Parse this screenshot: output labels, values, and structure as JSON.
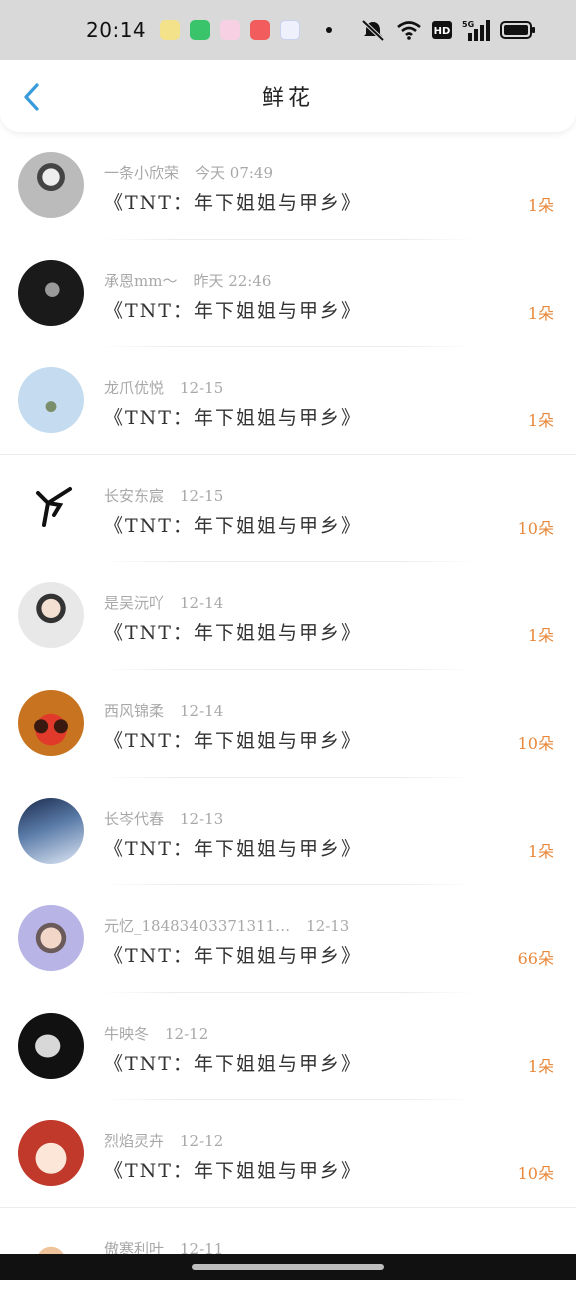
{
  "status_bar": {
    "time": "20:14",
    "icons": [
      "face-app-icon",
      "shopping-app-icon",
      "pink-app-icon",
      "store-app-icon",
      "browser-app-icon"
    ],
    "right_icons": [
      "mute-icon",
      "wifi-icon",
      "hd-icon",
      "signal-5g-icon",
      "battery-icon"
    ]
  },
  "header": {
    "title": "鲜花",
    "back_icon": "chevron-left-icon"
  },
  "accent_color": "#e8883a",
  "items": [
    {
      "name": "一条小欣荣",
      "time": "今天 07:49",
      "gift": "《TNT：年下姐姐与甲乡》",
      "count": "1朵",
      "avatar": "portrait-bw"
    },
    {
      "name": "承恩mm～",
      "time": "昨天 22:46",
      "gift": "《TNT：年下姐姐与甲乡》",
      "count": "1朵",
      "avatar": "portrait-dark"
    },
    {
      "name": "龙爪优悦",
      "time": "12-15",
      "gift": "《TNT：年下姐姐与甲乡》",
      "count": "1朵",
      "avatar": "sky-plant"
    },
    {
      "name": "长安东宸",
      "time": "12-15",
      "gift": "《TNT：年下姐姐与甲乡》",
      "count": "10朵",
      "avatar": "glyph"
    },
    {
      "name": "是吴沅吖",
      "time": "12-14",
      "gift": "《TNT：年下姐姐与甲乡》",
      "count": "1朵",
      "avatar": "portrait-light"
    },
    {
      "name": "西风锦柔",
      "time": "12-14",
      "gift": "《TNT：年下姐姐与甲乡》",
      "count": "10朵",
      "avatar": "cartoon-couple"
    },
    {
      "name": "长岑代春",
      "time": "12-13",
      "gift": "《TNT：年下姐姐与甲乡》",
      "count": "1朵",
      "avatar": "dancer"
    },
    {
      "name": "元忆_18483403371311…",
      "time": "12-13",
      "gift": "《TNT：年下姐姐与甲乡》",
      "count": "66朵",
      "avatar": "portrait-purple"
    },
    {
      "name": "牛映冬",
      "time": "12-12",
      "gift": "《TNT：年下姐姐与甲乡》",
      "count": "1朵",
      "avatar": "mask"
    },
    {
      "name": "烈焰灵卉",
      "time": "12-12",
      "gift": "《TNT：年下姐姐与甲乡》",
      "count": "10朵",
      "avatar": "cartoon-girl"
    },
    {
      "name": "傲寒利叶",
      "time": "12-11",
      "gift": "",
      "count": "",
      "avatar": "cat"
    }
  ]
}
